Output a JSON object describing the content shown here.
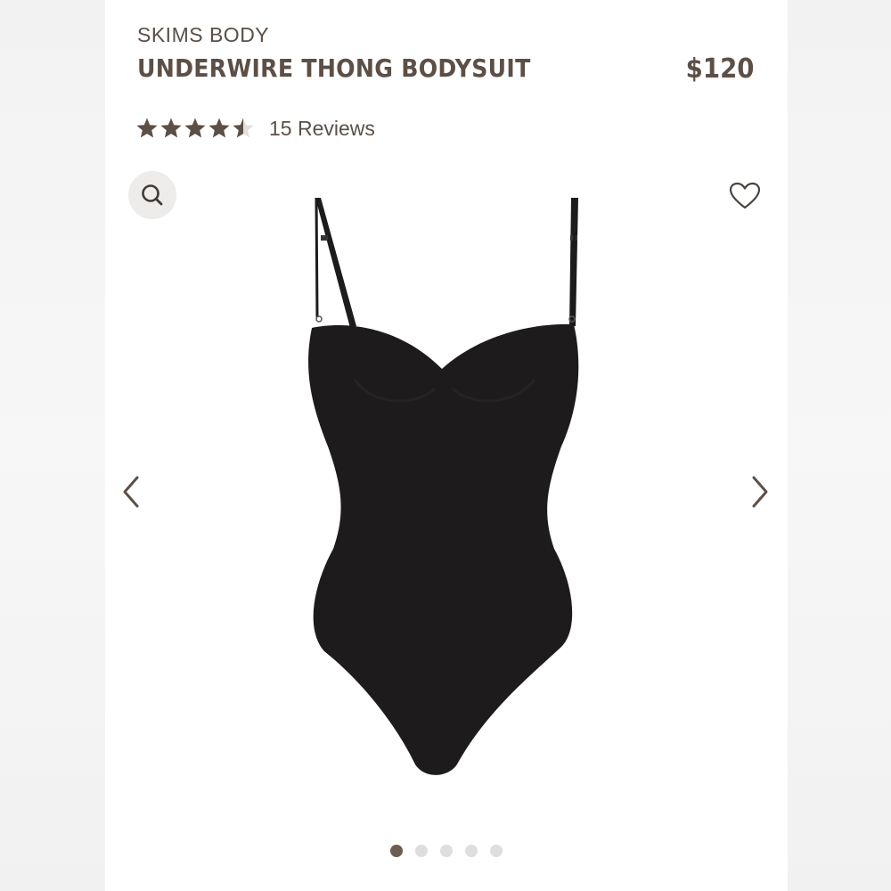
{
  "product": {
    "brand": "SKIMS BODY",
    "title": "UNDERWIRE THONG BODYSUIT",
    "price": "$120",
    "rating": 4.5,
    "rating_max": 5,
    "reviews_label": "15 Reviews"
  },
  "gallery": {
    "image_count": 5,
    "active_index": 0
  },
  "icons": {
    "zoom": "search-icon",
    "wishlist": "heart-icon",
    "prev": "chevron-left-icon",
    "next": "chevron-right-icon",
    "star": "star-icon"
  },
  "colors": {
    "text": "#5c4f46",
    "star_filled": "#5c4f46",
    "star_empty": "#e3e0dd",
    "dot_active": "#6b5d53",
    "dot_inactive": "#dedede",
    "product": "#1d1b1b"
  }
}
